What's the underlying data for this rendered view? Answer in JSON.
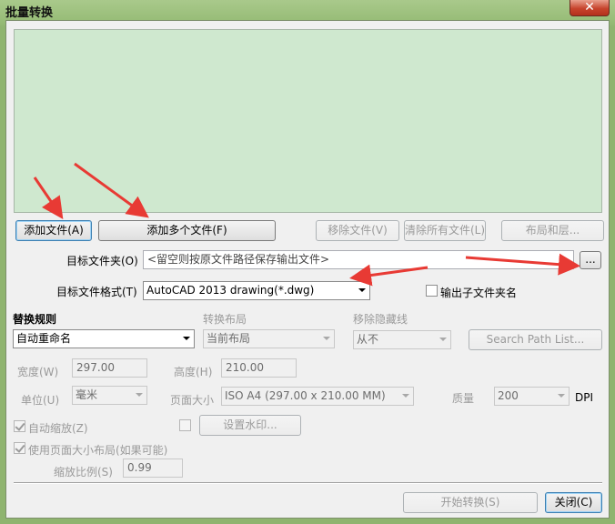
{
  "window": {
    "title": "批量转换",
    "close_glyph": "✕"
  },
  "buttons": {
    "add_file": "添加文件(A)",
    "add_multiple": "添加多个文件(F)",
    "remove_file": "移除文件(V)",
    "clear_all": "清除所有文件(L)",
    "layout_layers": "布局和层...",
    "browse": "...",
    "search_path": "Search Path List...",
    "watermark": "设置水印...",
    "start": "开始转换(S)",
    "close": "关闭(C)"
  },
  "target_folder": {
    "label": "目标文件夹(O)",
    "placeholder": "<留空则按原文件路径保存输出文件>"
  },
  "target_format": {
    "label": "目标文件格式(T)",
    "value": "AutoCAD 2013 drawing(*.dwg)",
    "output_subfolder_label": "输出子文件夹名"
  },
  "rules": {
    "replace_rule_label": "替换规则",
    "replace_rule_value": "自动重命名",
    "convert_layout_label": "转换布局",
    "convert_layout_value": "当前布局",
    "remove_hidden_label": "移除隐藏线",
    "remove_hidden_value": "从不"
  },
  "dimensions": {
    "width_label": "宽度(W)",
    "width_value": "297.00",
    "height_label": "高度(H)",
    "height_value": "210.00",
    "unit_label": "单位(U)",
    "unit_value": "毫米",
    "page_size_label": "页面大小",
    "page_size_value": "ISO A4 (297.00 x 210.00 MM)",
    "quality_label": "质量",
    "quality_value": "200",
    "dpi_label": "DPI"
  },
  "options": {
    "auto_scale_label": "自动缩放(Z)",
    "use_page_size_label": "使用页面大小布局(如果可能)",
    "scale_ratio_label": "缩放比例(S)",
    "scale_ratio_value": "0.99"
  },
  "colors": {
    "annotation_arrow": "#e83a34",
    "preview_bg": "#cfe8cf"
  }
}
